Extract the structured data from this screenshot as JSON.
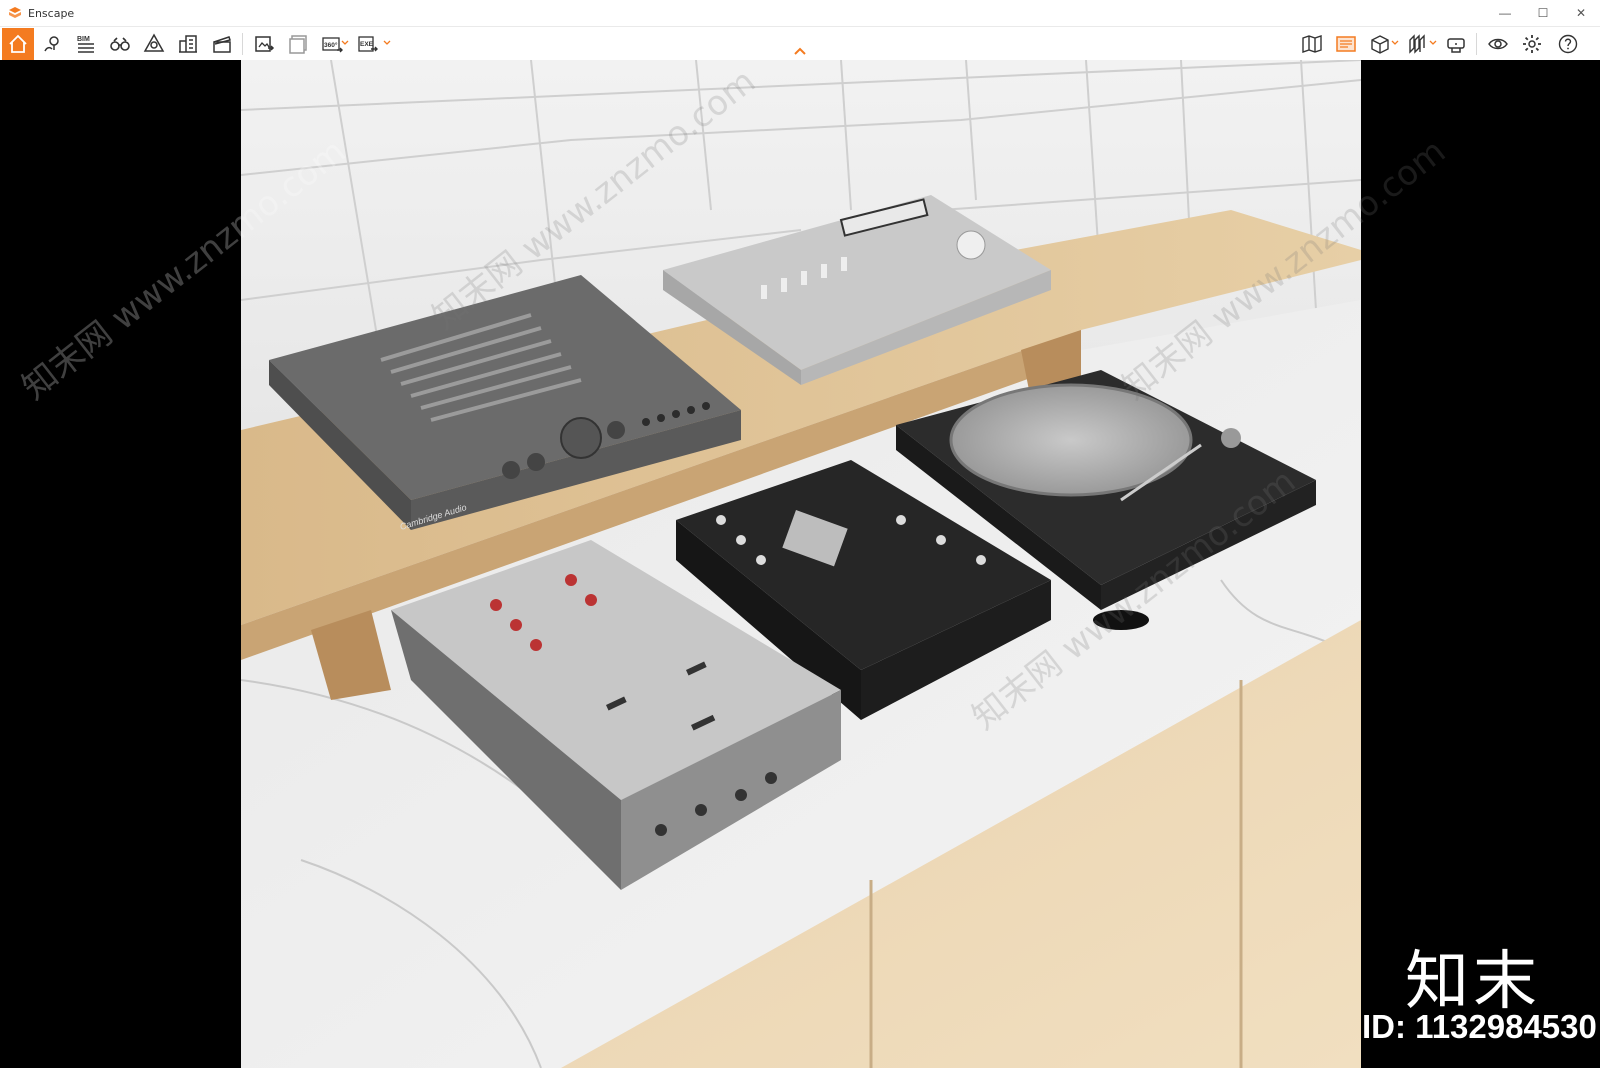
{
  "window": {
    "title": "Enscape",
    "controls": [
      "minimize",
      "maximize",
      "close"
    ]
  },
  "toolbar": {
    "left_buttons": [
      {
        "name": "home-icon"
      },
      {
        "name": "pin-location-icon"
      },
      {
        "name": "bim-icon",
        "label": "BIM"
      },
      {
        "name": "binoculars-icon"
      },
      {
        "name": "site-context-icon"
      },
      {
        "name": "building-icon"
      },
      {
        "name": "clapperboard-icon"
      },
      {
        "name": "render-image-icon"
      },
      {
        "name": "batch-render-icon"
      },
      {
        "name": "panorama-360-icon",
        "label": "360°"
      },
      {
        "name": "export-exe-icon",
        "label": "EXE"
      }
    ],
    "right_buttons": [
      {
        "name": "map-icon"
      },
      {
        "name": "asset-library-icon"
      },
      {
        "name": "cube-view-icon"
      },
      {
        "name": "section-icon"
      },
      {
        "name": "vr-headset-icon"
      },
      {
        "name": "visibility-icon"
      },
      {
        "name": "settings-icon"
      },
      {
        "name": "help-icon"
      }
    ],
    "accent_color": "#f47b20"
  },
  "viewport": {
    "brand_text": "Cambridge Audio"
  },
  "watermark": {
    "logo": "知末",
    "id_text": "ID: 1132984530",
    "diag_text": "知末网 www.znzmo.com"
  }
}
